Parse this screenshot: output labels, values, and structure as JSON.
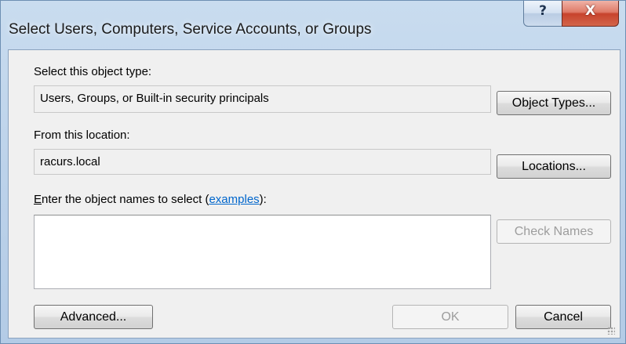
{
  "dialog": {
    "title": "Select Users, Computers, Service Accounts, or Groups",
    "help_glyph": "?",
    "close_glyph": "X"
  },
  "object_type": {
    "label": "Select this object type:",
    "value": "Users, Groups, or Built-in security principals",
    "button": "Object Types..."
  },
  "location": {
    "label": "From this location:",
    "value": "racurs.local",
    "button": "Locations..."
  },
  "names": {
    "label_accel": "E",
    "label_rest": "nter the object names to select (",
    "link": "examples",
    "label_end": "):",
    "value": "",
    "check_button": "Check Names"
  },
  "footer": {
    "advanced": "Advanced...",
    "ok": "OK",
    "cancel": "Cancel"
  }
}
